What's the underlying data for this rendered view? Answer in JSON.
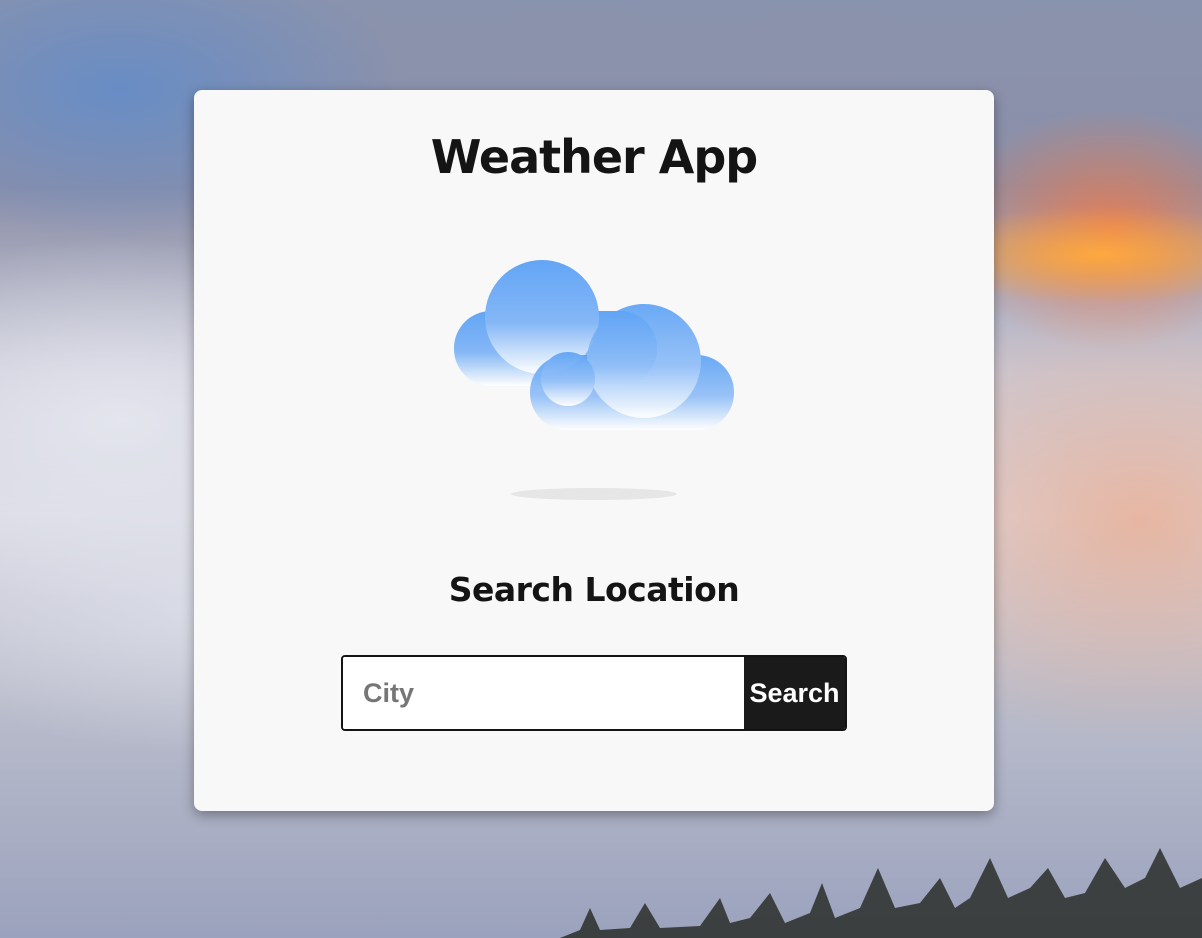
{
  "app": {
    "title": "Weather App"
  },
  "weather_icon": {
    "name": "cloudy-icon",
    "colors": [
      "#5ba1f5",
      "#ffffff"
    ]
  },
  "search": {
    "heading": "Search Location",
    "placeholder": "City",
    "value": "",
    "button_label": "Search"
  },
  "theme": {
    "card_background": "#f8f8f8",
    "text_color": "#141414",
    "button_background": "#1a1a1a",
    "button_text": "#ffffff"
  }
}
